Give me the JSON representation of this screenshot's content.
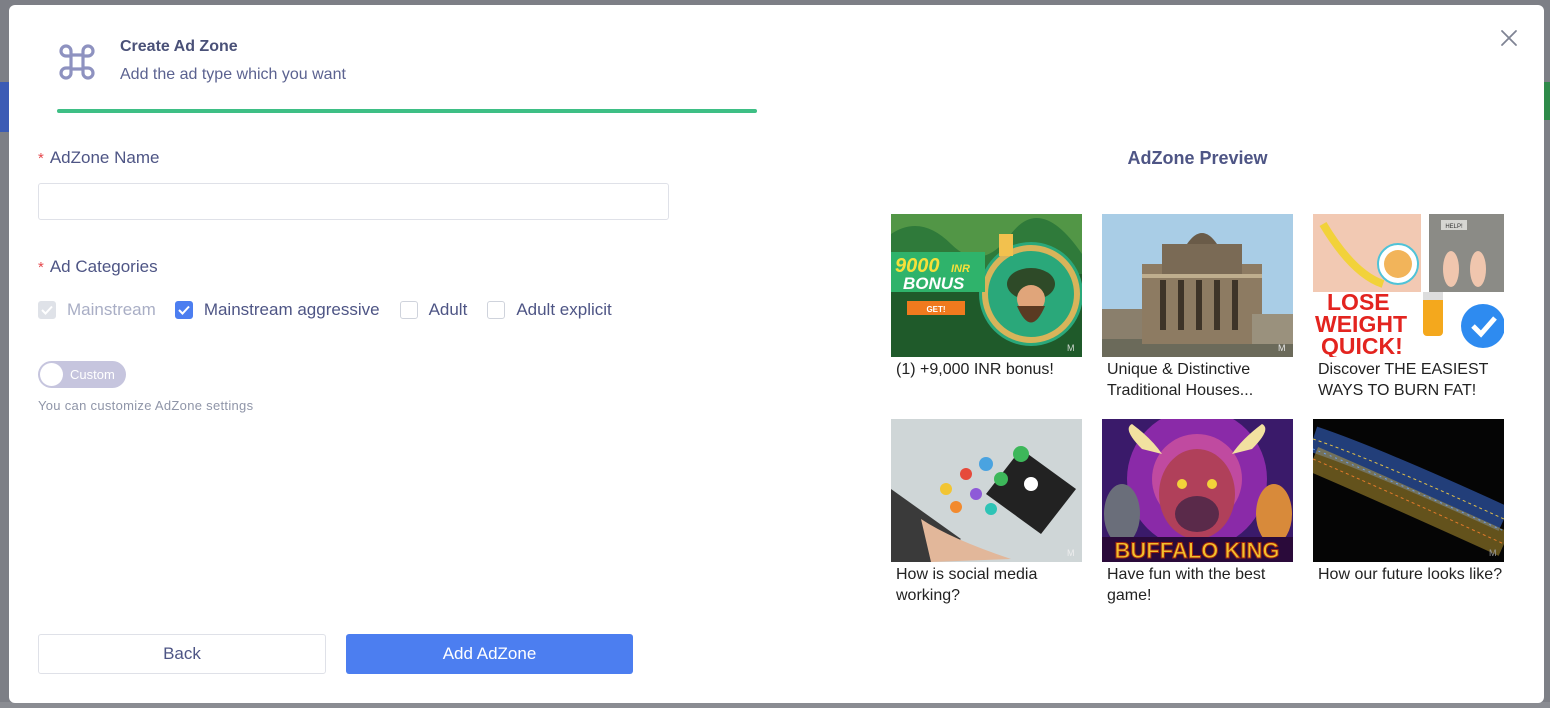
{
  "modal": {
    "title": "Create Ad Zone",
    "subtitle": "Add the ad type which you want",
    "progress_percent": 100,
    "header_icon": "command-icon",
    "close_icon": "close-icon"
  },
  "form": {
    "name_label": "AdZone Name",
    "name_value": "",
    "categories_label": "Ad Categories",
    "required_mark": "*",
    "categories": [
      {
        "label": "Mainstream",
        "checked": true,
        "disabled": true
      },
      {
        "label": "Mainstream aggressive",
        "checked": true,
        "disabled": false
      },
      {
        "label": "Adult",
        "checked": false,
        "disabled": false
      },
      {
        "label": "Adult explicit",
        "checked": false,
        "disabled": false
      }
    ],
    "toggle_label": "Custom",
    "toggle_on": false,
    "hint": "You can customize AdZone settings"
  },
  "buttons": {
    "back": "Back",
    "add": "Add AdZone"
  },
  "preview": {
    "title": "AdZone Preview",
    "ads": [
      {
        "caption": "(1) +9,000 INR bonus!",
        "image": "casino-bonus-image",
        "bonus_amount": "9000",
        "bonus_currency": "INR",
        "bonus_word": "BONUS",
        "cta": "GET!"
      },
      {
        "caption": "Unique & Distinctive Traditional Houses...",
        "image": "traditional-house-image"
      },
      {
        "caption": "Discover THE EASIEST WAYS TO BURN FAT!",
        "image": "weight-loss-image",
        "headline_1": "LOSE",
        "headline_2": "WEIGHT",
        "headline_3": "QUICK!",
        "scale_sign": "HELP!"
      },
      {
        "caption": "How is social media working?",
        "image": "social-media-phone-image"
      },
      {
        "caption": "Have fun with the best game!",
        "image": "buffalo-game-image",
        "game_title": "BUFFALO KING"
      },
      {
        "caption": "How our future looks like?",
        "image": "nanotube-image"
      }
    ],
    "ad_badge": "M"
  },
  "colors": {
    "primary": "#4c7ef0",
    "progress": "#3ebf85",
    "text": "#4e5585",
    "required": "#e5484d"
  }
}
